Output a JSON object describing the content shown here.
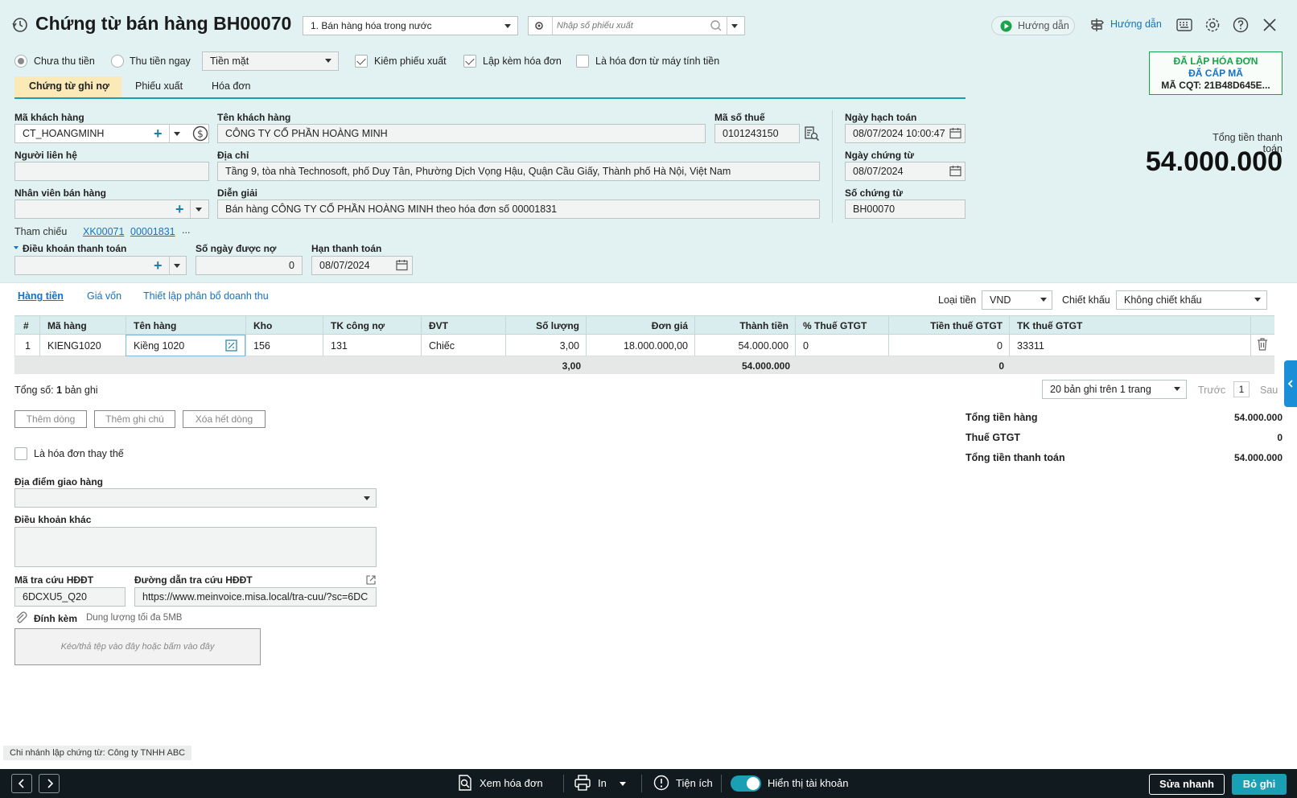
{
  "header": {
    "title": "Chứng từ bán hàng BH00070",
    "sale_type": "1. Bán hàng hóa trong nước",
    "export_search_placeholder": "Nhập số phiếu xuất",
    "guide_button_1": "Hướng dẫn",
    "guide_button_2": "Hướng dẫn"
  },
  "options": {
    "radio_unpaid": "Chưa thu tiền",
    "radio_paid": "Thu tiền ngay",
    "payment_method": "Tiền mặt",
    "chk_export": "Kiêm phiếu xuất",
    "chk_invoice": "Lập kèm hóa đơn",
    "chk_register": "Là hóa đơn từ máy tính tiền"
  },
  "status_box": {
    "line1": "ĐÃ LẬP HÓA ĐƠN",
    "line2": "ĐÃ CẤP MÃ",
    "line3": "MÃ CQT: 21B48D645E..."
  },
  "tabs": [
    "Chứng từ ghi nợ",
    "Phiếu xuất",
    "Hóa đơn"
  ],
  "form": {
    "customer_code_label": "Mã khách hàng",
    "customer_code": "CT_HOANGMINH",
    "customer_name_label": "Tên khách hàng",
    "customer_name": "CÔNG TY CỔ PHẦN HOÀNG MINH",
    "tax_code_label": "Mã số thuế",
    "tax_code": "0101243150",
    "posting_date_label": "Ngày hạch toán",
    "posting_date": "08/07/2024 10:00:47",
    "contact_label": "Người liên hệ",
    "contact": "",
    "address_label": "Địa chỉ",
    "address": "Tầng 9, tòa nhà Technosoft, phố Duy Tân, Phường Dịch Vọng Hậu, Quận Cầu Giấy, Thành phố Hà Nội, Việt Nam",
    "doc_date_label": "Ngày chứng từ",
    "doc_date": "08/07/2024",
    "sales_staff_label": "Nhân viên bán hàng",
    "sales_staff": "",
    "description_label": "Diễn giải",
    "description": "Bán hàng CÔNG TY CỔ PHẦN HOÀNG MINH theo hóa đơn số 00001831",
    "doc_no_label": "Số chứng từ",
    "doc_no": "BH00070",
    "reference_label": "Tham chiếu",
    "ref1": "XK00071",
    "ref2": "00001831",
    "ref_more": "...",
    "payment_terms_label": "Điều khoản thanh toán",
    "payment_terms": "",
    "credit_days_label": "Số ngày được nợ",
    "credit_days": "0",
    "due_date_label": "Hạn thanh toán",
    "due_date": "08/07/2024"
  },
  "total_panel": {
    "label": "Tổng tiền thanh toán",
    "value": "54.000.000"
  },
  "subtabs": [
    "Hàng tiền",
    "Giá vốn",
    "Thiết lập phân bổ doanh thu"
  ],
  "currency": {
    "label": "Loại tiền",
    "value": "VND"
  },
  "discount": {
    "label": "Chiết khấu",
    "value": "Không chiết khấu"
  },
  "table": {
    "headers": [
      "#",
      "Mã hàng",
      "Tên hàng",
      "Kho",
      "TK công nợ",
      "ĐVT",
      "Số lượng",
      "Đơn giá",
      "Thành tiền",
      "% Thuế GTGT",
      "Tiền thuế GTGT",
      "TK thuế GTGT"
    ],
    "row": {
      "no": "1",
      "code": "KIENG1020",
      "name": "Kiềng 1020",
      "warehouse": "156",
      "account": "131",
      "unit": "Chiếc",
      "qty": "3,00",
      "price": "18.000.000,00",
      "amount": "54.000.000",
      "vat_rate": "0",
      "vat_amount": "0",
      "vat_account": "33311"
    },
    "totals": {
      "qty": "3,00",
      "amount": "54.000.000",
      "vat_amount": "0"
    }
  },
  "record_count": {
    "prefix": "Tổng số:",
    "count": "1",
    "suffix": "bản ghi"
  },
  "pagination": {
    "per_page": "20 bản ghi trên 1 trang",
    "prev": "Trước",
    "page": "1",
    "next": "Sau"
  },
  "row_buttons": {
    "add_row": "Thêm dòng",
    "add_note": "Thêm ghi chú",
    "delete_all": "Xóa hết dòng"
  },
  "summary": {
    "goods_label": "Tổng tiền hàng",
    "goods_value": "54.000.000",
    "vat_label": "Thuế GTGT",
    "vat_value": "0",
    "total_label": "Tổng tiền thanh toán",
    "total_value": "54.000.000"
  },
  "bottom": {
    "replace_invoice": "Là hóa đơn thay thế",
    "delivery_label": "Địa điểm giao hàng",
    "other_terms_label": "Điều khoản khác",
    "lookup_code_label": "Mã tra cứu HĐĐT",
    "lookup_code": "6DCXU5_Q20",
    "lookup_url_label": "Đường dẫn tra cứu HĐĐT",
    "lookup_url": "https://www.meinvoice.misa.local/tra-cuu/?sc=6DC",
    "attach_label": "Đính kèm",
    "attach_hint": "Dung lượng tối đa 5MB",
    "drop_hint": "Kéo/thả tệp vào đây hoặc bấm vào đây",
    "branch": "Chi nhánh lập chứng từ: Công ty TNHH ABC"
  },
  "footer": {
    "view_invoice": "Xem hóa đơn",
    "print": "In",
    "utilities": "Tiện ích",
    "show_accounts": "Hiển thị tài khoản",
    "quick_edit": "Sửa nhanh",
    "save": "Bỏ ghi"
  },
  "colors": {
    "accent": "#1a9fb5",
    "header_bg": "#e2f2f2",
    "status_green": "#18a34a"
  }
}
